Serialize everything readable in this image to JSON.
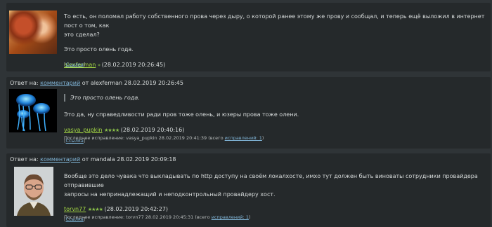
{
  "comments": [
    {
      "paragraph1": "То есть, он поломал работу собственного прова через дыру, о которой ранее этому же прову и сообщал, и теперь ещё выложил в интернет пост о том, как",
      "paragraph1b": "это сделал?",
      "paragraph2": "Это просто олень года.",
      "author": "alexferman",
      "author_marker": "»",
      "datetime": "(28.02.2019 20:26:45)",
      "link": "Ссылка"
    },
    {
      "reply_prefix": "Ответ на: ",
      "reply_link": "комментарий",
      "reply_suffix": " от alexferman 28.02.2019 20:26:45",
      "quote": "Это просто олень года.",
      "text": "Это да, ну справедливости ради пров тоже олень, и юзеры прова тоже олени.",
      "author": "vasya_pupkin",
      "stars": "★★★★",
      "datetime": "(28.02.2019 20:40:16)",
      "edit_prefix": "Последнее исправление: vasya_pupkin 28.02.2019 20:41:39 (всего ",
      "edit_link": "исправлений: 1",
      "edit_suffix": ")",
      "link": "Ссылка"
    },
    {
      "reply_prefix": "Ответ на: ",
      "reply_link": "комментарий",
      "reply_suffix": " от mandala 28.02.2019 20:09:18",
      "text1": "Вообще это дело чувака что выкладывать по http доступу на своём локалхосте, имхо тут должен быть виноваты сотрудники провайдера отправившие",
      "text2": "запросы на непринадлежащий и неподконтрольный провайдеру хост.",
      "author": "torvn77",
      "stars": "★★★★",
      "datetime": "(28.02.2019 20:42:27)",
      "edit_prefix": "Последнее исправление: torvn77 28.02.2019 20:45:31 (всего ",
      "edit_link": "исправлений: 1",
      "edit_suffix": ")",
      "link": "Ссылка"
    }
  ]
}
